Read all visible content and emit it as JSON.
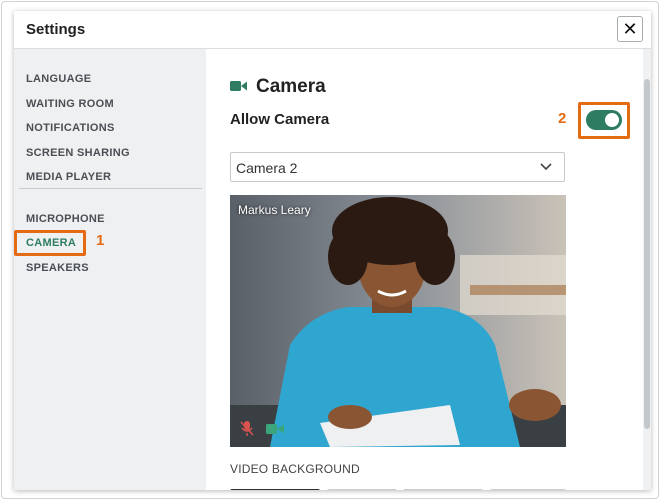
{
  "dialog": {
    "title": "Settings",
    "close_icon": "close-icon"
  },
  "sidebar": {
    "group1": [
      "LANGUAGE",
      "WAITING ROOM",
      "NOTIFICATIONS",
      "SCREEN SHARING",
      "MEDIA PLAYER"
    ],
    "group2": [
      "MICROPHONE",
      "CAMERA",
      "SPEAKERS"
    ],
    "active": "CAMERA"
  },
  "callouts": {
    "one": "1",
    "two": "2"
  },
  "content": {
    "section_title": "Camera",
    "section_icon": "video-camera-icon",
    "allow_camera_label": "Allow Camera",
    "allow_camera_on": true,
    "camera_select_value": "Camera 2",
    "video_participant_name": "Markus Leary",
    "mic_icon": "mic-muted-icon",
    "cam_icon": "video-camera-icon",
    "video_background_label": "VIDEO BACKGROUND"
  },
  "colors": {
    "accent": "#2e7d62",
    "highlight": "#e56b12",
    "muted": "#d9534f"
  }
}
